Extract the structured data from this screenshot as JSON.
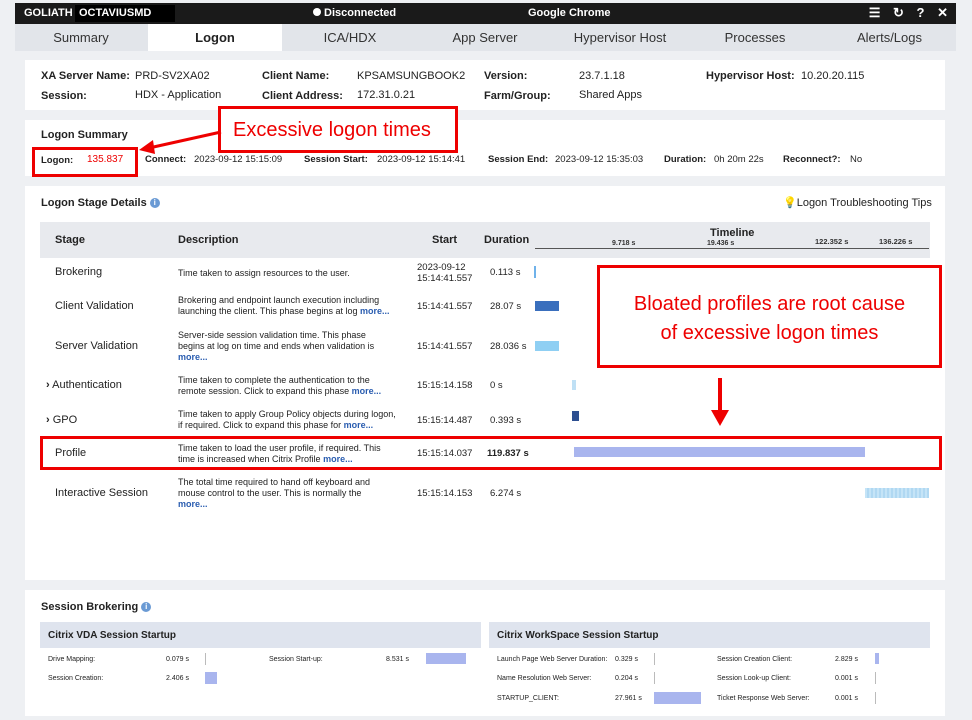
{
  "titlebar": {
    "brand": "GOLIATH",
    "host": "OCTAVIUSMD",
    "status": "Disconnected",
    "app": "Google Chrome",
    "icons": [
      "menu-icon",
      "refresh-icon",
      "help-icon",
      "close-icon"
    ]
  },
  "tabs": [
    "Summary",
    "Logon",
    "ICA/HDX",
    "App Server",
    "Hypervisor Host",
    "Processes",
    "Alerts/Logs"
  ],
  "active_tab": "Logon",
  "server_info": {
    "xa_server_label": "XA Server Name:",
    "xa_server": "PRD-SV2XA02",
    "session_label": "Session:",
    "session": "HDX - Application",
    "client_name_label": "Client Name:",
    "client_name": "KPSAMSUNGBOOK2",
    "client_address_label": "Client Address:",
    "client_address": "172.31.0.21",
    "version_label": "Version:",
    "version": "23.7.1.18",
    "farm_label": "Farm/Group:",
    "farm": "Shared Apps",
    "hypervisor_label": "Hypervisor Host:",
    "hypervisor": "10.20.20.115"
  },
  "logon_summary": {
    "title": "Logon Summary",
    "logon_label": "Logon:",
    "logon": "135.837",
    "connect_label": "Connect:",
    "connect": "2023-09-12 15:15:09",
    "session_start_label": "Session Start:",
    "session_start": "2023-09-12 15:14:41",
    "session_end_label": "Session End:",
    "session_end": "2023-09-12 15:35:03",
    "duration_label": "Duration:",
    "duration": "0h 20m 22s",
    "reconnect_label": "Reconnect?:",
    "reconnect": "No"
  },
  "stage_details": {
    "title": "Logon Stage Details",
    "tips": "Logon Troubleshooting Tips",
    "headers": {
      "stage": "Stage",
      "description": "Description",
      "start": "Start",
      "duration": "Duration",
      "timeline": "Timeline"
    },
    "ticks": [
      "9.718 s",
      "19.436 s",
      "122.352 s",
      "136.226 s"
    ],
    "rows": [
      {
        "stage": "Brokering",
        "desc1": "Time taken to assign resources to the user.",
        "desc2": "",
        "desc3": "",
        "more": "",
        "start1": "2023-09-12",
        "start2": "15:14:41.557",
        "duration": "0.113 s",
        "color": "#6fb2ea"
      },
      {
        "stage": "Client Validation",
        "desc1": "Brokering and endpoint launch execution including",
        "desc2": "launching the client. This phase begins at log",
        "desc3": "",
        "more": "more...",
        "start1": "15:14:41.557",
        "start2": "",
        "duration": "28.07 s",
        "color": "#3a6fbd"
      },
      {
        "stage": "Server Validation",
        "desc1": "Server-side session validation time. This phase",
        "desc2": "begins at log on time and ends when validation is",
        "desc3": "",
        "more": "more...",
        "start1": "15:14:41.557",
        "start2": "",
        "duration": "28.036 s",
        "color": "#8fcff3"
      },
      {
        "stage": "Authentication",
        "desc1": "Time taken to complete the authentication to the",
        "desc2": "remote session. Click to expand this phase",
        "desc3": "",
        "more": "more...",
        "start1": "15:15:14.158",
        "start2": "",
        "duration": "0 s",
        "color": "#bfe0f5"
      },
      {
        "stage": "GPO",
        "desc1": "Time taken to apply Group Policy objects during logon,",
        "desc2": "if required. Click to expand this phase for",
        "desc3": "",
        "more": "more...",
        "start1": "15:15:14.487",
        "start2": "",
        "duration": "0.393 s",
        "color": "#2d4f91"
      },
      {
        "stage": "Profile",
        "desc1": "Time taken to load the user profile, if required. This",
        "desc2": "time is increased when Citrix Profile",
        "desc3": "",
        "more": "more...",
        "start1": "15:15:14.037",
        "start2": "",
        "duration": "119.837 s",
        "color": "#a9b5ee"
      },
      {
        "stage": "Interactive Session",
        "desc1": "The total time required to hand off keyboard and",
        "desc2": "mouse control to the user. This is normally the",
        "desc3": "",
        "more": "more...",
        "start1": "15:15:14.153",
        "start2": "",
        "duration": "6.274 s",
        "color": "#c5e4f7"
      }
    ]
  },
  "callouts": {
    "logon": "Excessive logon times",
    "profile_line1": "Bloated profiles are root cause",
    "profile_line2": "of excessive logon times"
  },
  "brokering": {
    "title": "Session Brokering",
    "vda_title": "Citrix VDA Session Startup",
    "ws_title": "Citrix WorkSpace Session Startup",
    "vda": [
      {
        "label": "Drive Mapping:",
        "value": "0.079 s"
      },
      {
        "label": "Session Start-up:",
        "value": "8.531 s"
      },
      {
        "label": "Session Creation:",
        "value": "2.406 s"
      }
    ],
    "ws": [
      {
        "label": "Launch Page Web Server Duration:",
        "value": "0.329 s"
      },
      {
        "label": "Session Creation Client:",
        "value": "2.829 s"
      },
      {
        "label": "Name Resolution Web Server:",
        "value": "0.204 s"
      },
      {
        "label": "Session Look-up Client:",
        "value": "0.001 s"
      },
      {
        "label": "STARTUP_CLIENT:",
        "value": "27.961 s"
      },
      {
        "label": "Ticket Response Web Server:",
        "value": "0.001 s"
      }
    ]
  }
}
